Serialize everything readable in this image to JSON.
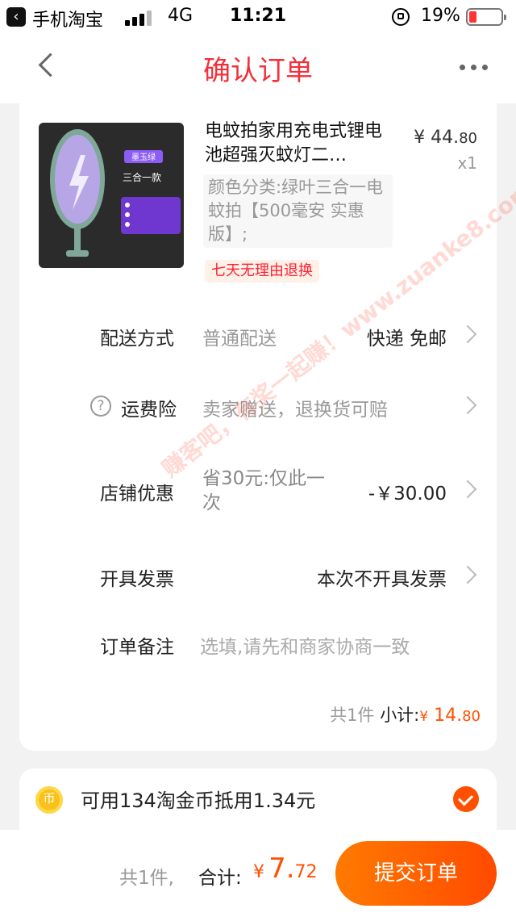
{
  "status_bar": {
    "app_name": "手机淘宝",
    "network": "4G",
    "time": "11:21",
    "battery": "19%"
  },
  "nav": {
    "title": "确认订单",
    "back_icon": "chevron-left-icon",
    "more_icon": "more-dots-icon"
  },
  "product": {
    "title": "电蚊拍家用充电式锂电池超强灭蚊灯二…",
    "price_symbol": "¥",
    "price_int": "44.",
    "price_cents": "80",
    "quantity": "x1",
    "sku": "颜色分类:绿叶三合一电蚊拍【500毫安 实惠版】;",
    "tag": "七天无理由退换",
    "image_badge": "墨玉绿",
    "image_caption": "三合一款"
  },
  "rows": {
    "delivery": {
      "label": "配送方式",
      "desc": "普通配送",
      "value": "快递 免邮"
    },
    "insurance": {
      "label": "运费险",
      "desc": "卖家赠送，退换货可赔"
    },
    "discount": {
      "label": "店铺优惠",
      "desc": "省30元:仅此一次",
      "value": "-￥30.00"
    },
    "invoice": {
      "label": "开具发票",
      "value": "本次不开具发票"
    },
    "note": {
      "label": "订单备注",
      "placeholder": "选填,请先和商家协商一致"
    }
  },
  "subtotal": {
    "count": "共1件",
    "label": "小计:",
    "symbol": "¥",
    "int": "14.",
    "cents": "80"
  },
  "coins": {
    "text": "可用134淘金币抵用1.34元"
  },
  "bottom": {
    "count": "共1件,",
    "label": "合计:",
    "symbol": "¥",
    "int": "7.",
    "cents": "72",
    "submit": "提交订单"
  },
  "watermark": "赚客吧，有奖一起赚！www.zuanke8.com",
  "colors": {
    "accent": "#ff5000",
    "title_red": "#f2303a"
  }
}
